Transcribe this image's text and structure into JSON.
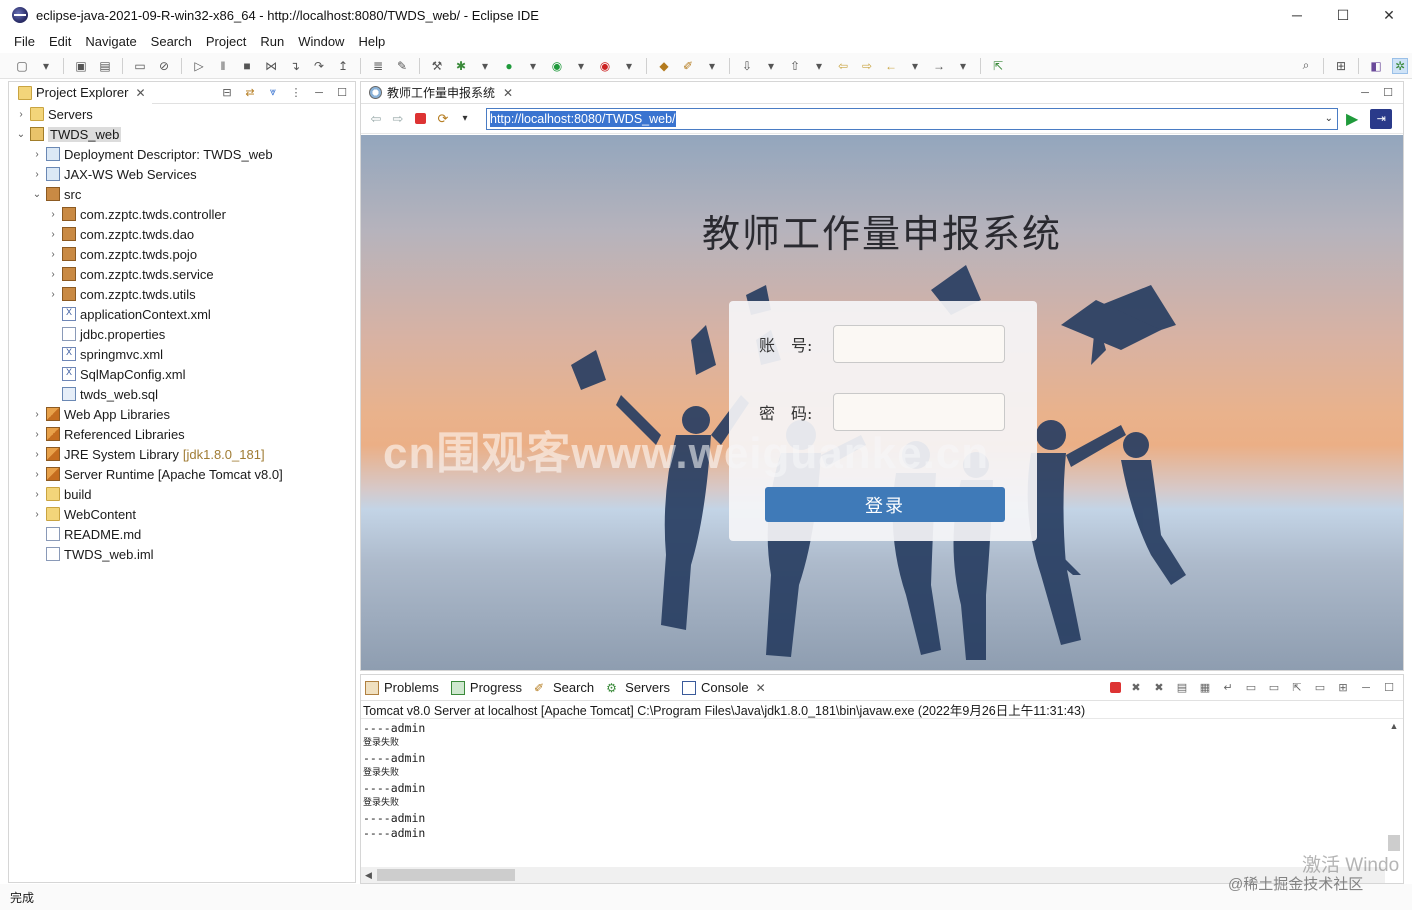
{
  "window": {
    "title": "eclipse-java-2021-09-R-win32-x86_64 - http://localhost:8080/TWDS_web/ - Eclipse IDE",
    "controls": [
      "─",
      "☐",
      "✕"
    ]
  },
  "menu": [
    {
      "label": "File"
    },
    {
      "label": "Edit"
    },
    {
      "label": "Navigate"
    },
    {
      "label": "Search"
    },
    {
      "label": "Project"
    },
    {
      "label": "Run"
    },
    {
      "label": "Window"
    },
    {
      "label": "Help"
    }
  ],
  "explorer": {
    "tab_label": "Project Explorer",
    "tree": [
      {
        "label": "Servers",
        "depth": 0,
        "icon": "folder",
        "chev": "›"
      },
      {
        "label": "TWDS_web",
        "depth": 0,
        "icon": "project",
        "chev": "⌄",
        "selected": true
      },
      {
        "label": "Deployment Descriptor: TWDS_web",
        "depth": 1,
        "icon": "web",
        "chev": "›"
      },
      {
        "label": "JAX-WS Web Services",
        "depth": 1,
        "icon": "web",
        "chev": "›"
      },
      {
        "label": "src",
        "depth": 1,
        "icon": "pkg",
        "chev": "⌄"
      },
      {
        "label": "com.zzptc.twds.controller",
        "depth": 2,
        "icon": "pkg",
        "chev": "›"
      },
      {
        "label": "com.zzptc.twds.dao",
        "depth": 2,
        "icon": "pkg",
        "chev": "›"
      },
      {
        "label": "com.zzptc.twds.pojo",
        "depth": 2,
        "icon": "pkg",
        "chev": "›"
      },
      {
        "label": "com.zzptc.twds.service",
        "depth": 2,
        "icon": "pkg",
        "chev": "›"
      },
      {
        "label": "com.zzptc.twds.utils",
        "depth": 2,
        "icon": "pkg",
        "chev": "›"
      },
      {
        "label": "applicationContext.xml",
        "depth": 2,
        "icon": "xml",
        "chev": ""
      },
      {
        "label": "jdbc.properties",
        "depth": 2,
        "icon": "file",
        "chev": ""
      },
      {
        "label": "springmvc.xml",
        "depth": 2,
        "icon": "xml",
        "chev": ""
      },
      {
        "label": "SqlMapConfig.xml",
        "depth": 2,
        "icon": "xml",
        "chev": ""
      },
      {
        "label": "twds_web.sql",
        "depth": 2,
        "icon": "sql",
        "chev": ""
      },
      {
        "label": "Web App Libraries",
        "depth": 1,
        "icon": "lib",
        "chev": "›"
      },
      {
        "label": "Referenced Libraries",
        "depth": 1,
        "icon": "lib",
        "chev": "›"
      },
      {
        "label": "JRE System Library",
        "depth": 1,
        "icon": "lib",
        "chev": "›",
        "decor": "[jdk1.8.0_181]"
      },
      {
        "label": "Server Runtime [Apache Tomcat v8.0]",
        "depth": 1,
        "icon": "lib",
        "chev": "›"
      },
      {
        "label": "build",
        "depth": 1,
        "icon": "folder",
        "chev": "›"
      },
      {
        "label": "WebContent",
        "depth": 1,
        "icon": "folder",
        "chev": "›"
      },
      {
        "label": "README.md",
        "depth": 1,
        "icon": "file",
        "chev": ""
      },
      {
        "label": "TWDS_web.iml",
        "depth": 1,
        "icon": "file",
        "chev": ""
      }
    ]
  },
  "browser": {
    "tab_label": "教师工作量申报系统",
    "url": "http://localhost:8080/TWDS_web/",
    "page": {
      "heading": "教师工作量申报系统",
      "account_label": "账　号:",
      "password_label": "密　码:",
      "login_button": "登录",
      "watermark": "cn围观客www.weiguanke.cn"
    }
  },
  "console": {
    "tabs": [
      {
        "label": "Problems"
      },
      {
        "label": "Progress"
      },
      {
        "label": "Search"
      },
      {
        "label": "Servers"
      },
      {
        "label": "Console",
        "closable": true
      }
    ],
    "description": "Tomcat v8.0 Server at localhost [Apache Tomcat] C:\\Program Files\\Java\\jdk1.8.0_181\\bin\\javaw.exe  (2022年9月26日上午11:31:43)",
    "lines": [
      {
        "text": "----admin",
        "small": false
      },
      {
        "text": "登录失败",
        "small": true
      },
      {
        "text": "----admin",
        "small": false
      },
      {
        "text": "登录失败",
        "small": true
      },
      {
        "text": "----admin",
        "small": false
      },
      {
        "text": "登录失败",
        "small": true
      },
      {
        "text": "----admin",
        "small": false
      },
      {
        "text": "----admin",
        "small": false
      }
    ]
  },
  "status": {
    "text": "完成"
  },
  "overlays": {
    "activate": "激活 Windo",
    "credit": "@稀土掘金技术社区"
  },
  "colors": {
    "accent": "#3a74d0",
    "login_button": "#3f7ab8",
    "stop_red": "#dd3333"
  }
}
